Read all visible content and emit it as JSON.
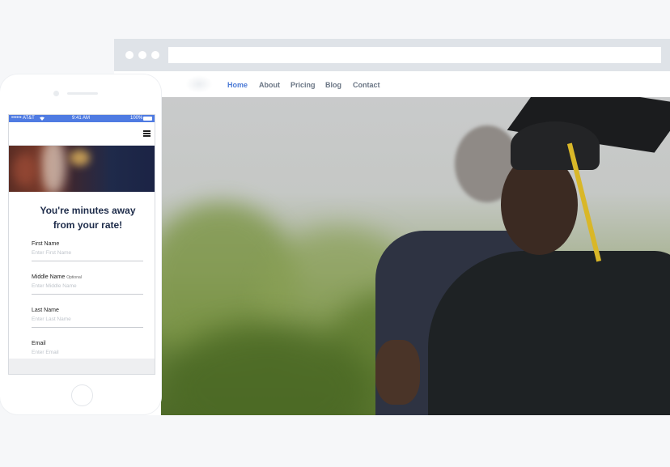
{
  "browser": {
    "nav": [
      {
        "label": "Home",
        "active": true
      },
      {
        "label": "About",
        "active": false
      },
      {
        "label": "Pricing",
        "active": false
      },
      {
        "label": "Blog",
        "active": false
      },
      {
        "label": "Contact",
        "active": false
      }
    ]
  },
  "phone": {
    "status": {
      "carrier": "•••••• AT&T",
      "time": "9:41 AM",
      "battery": "100%"
    },
    "form": {
      "title_line1": "You're minutes away",
      "title_line2": "from your rate!",
      "fields": [
        {
          "label": "First Name",
          "optional": "",
          "placeholder": "Enter First Name"
        },
        {
          "label": "Middle Name",
          "optional": "Optional",
          "placeholder": "Enter Middle Name"
        },
        {
          "label": "Last Name",
          "optional": "",
          "placeholder": "Enter Last Name"
        },
        {
          "label": "Email",
          "optional": "",
          "placeholder": "Enter Email"
        }
      ]
    }
  },
  "colors": {
    "accent": "#4b7ad6",
    "status_bar": "#4f7be2",
    "title": "#1e2c4a",
    "nav_text": "#6a7584"
  },
  "icons": {
    "menu": "hamburger-menu-icon",
    "wifi": "wifi-icon"
  }
}
